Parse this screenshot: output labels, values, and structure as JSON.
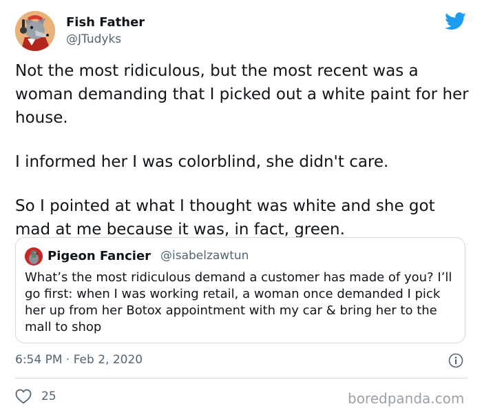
{
  "tweet": {
    "author": {
      "name": "Fish Father",
      "handle": "@JTudyks",
      "avatar_icon": "wolf-avatar-icon"
    },
    "paragraphs": [
      "Not the most ridiculous, but the most recent was a woman demanding that I picked out a white paint for her house.",
      "I informed her I was colorblind, she didn't care.",
      "So I pointed at what I thought was white and she got mad at me because it was, in fact, green."
    ],
    "quote": {
      "author_name": "Pigeon Fancier",
      "author_handle": "@isabelzawtun",
      "avatar_icon": "pigeon-avatar-icon",
      "text": "What’s the most ridiculous demand a customer has made of you? I’ll go first: when I was working retail, a woman once demanded I pick her up from her Botox appointment with my car & bring her to the mall to shop"
    },
    "timestamp": "6:54 PM · Feb 2, 2020",
    "likes": "25"
  },
  "watermark": "boredpanda.com",
  "icons": {
    "brand": "twitter-bird-icon",
    "info": "info-icon",
    "like": "heart-icon"
  },
  "colors": {
    "twitter_blue": "#1d9bf0",
    "text_primary": "#0f1419",
    "text_secondary": "#536471",
    "border": "#cfd9de"
  }
}
